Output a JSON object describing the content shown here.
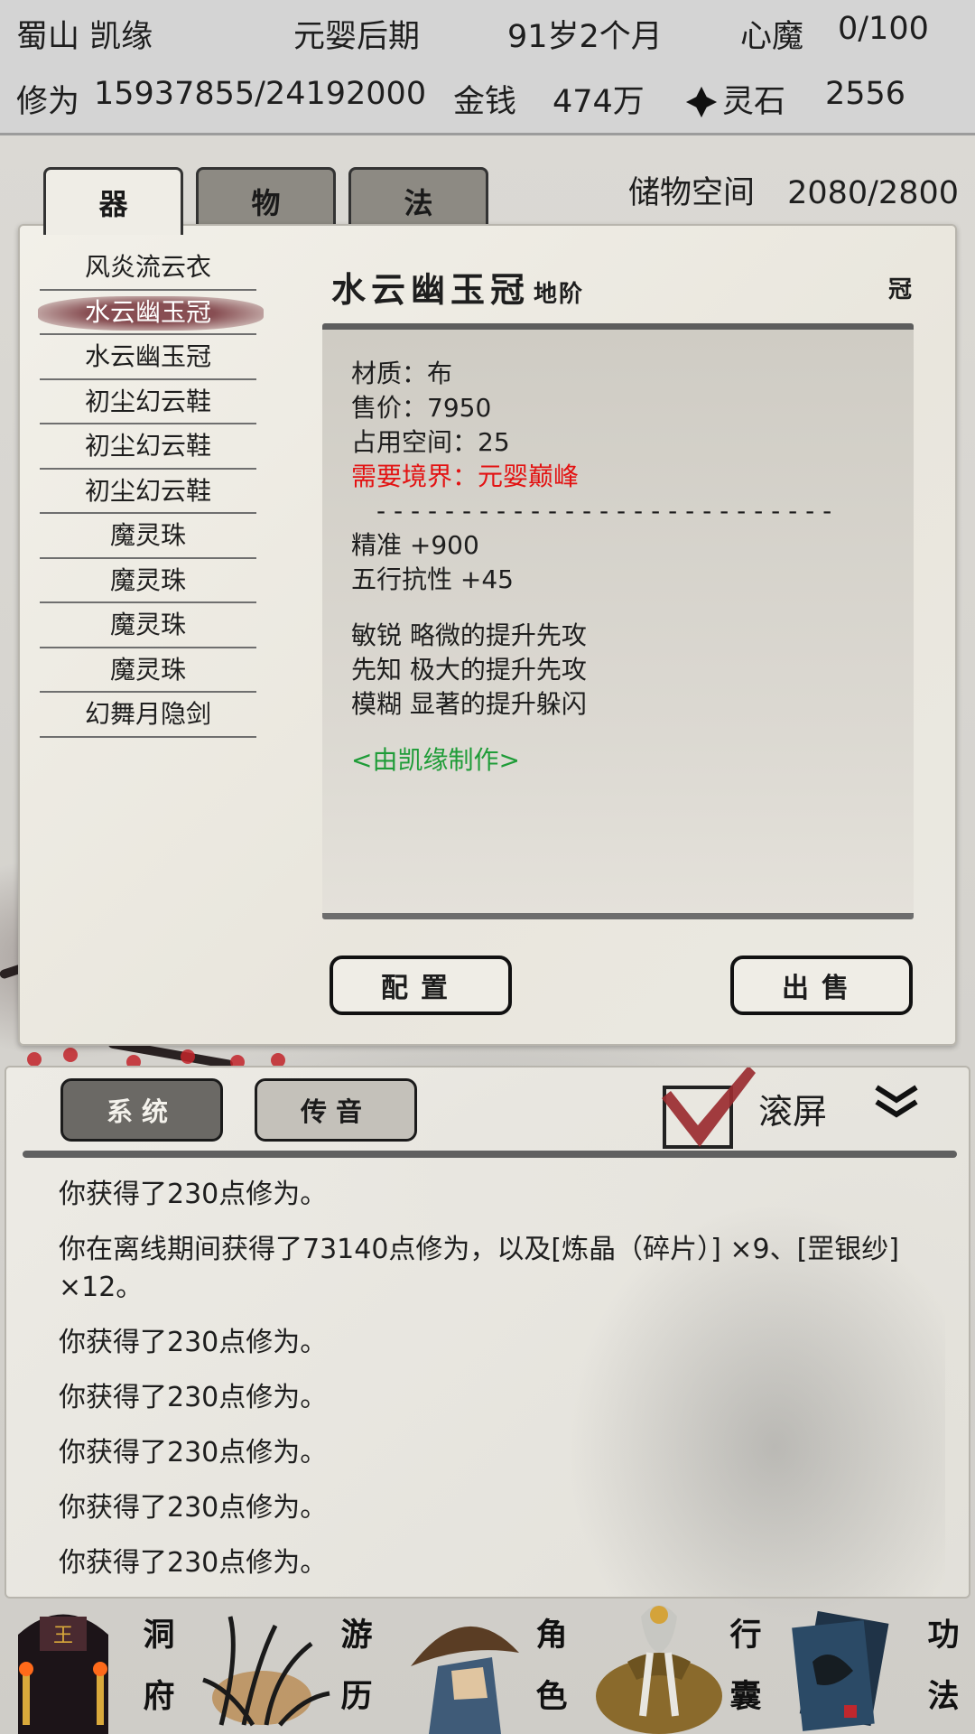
{
  "header": {
    "location_name": "蜀山 凯缘",
    "realm": "元婴后期",
    "age": "91岁2个月",
    "demon_label": "心魔",
    "demon_value": "0/100",
    "cultivation_label": "修为",
    "cultivation_value": "15937855/24192000",
    "money_label": "金钱",
    "money_value": "474万",
    "stone_label": "灵石",
    "stone_value": "2556"
  },
  "tabs": [
    "器",
    "物",
    "法"
  ],
  "storage": {
    "label": "储物空间",
    "value": "2080/2800"
  },
  "items": [
    "风炎流云衣",
    "水云幽玉冠",
    "水云幽玉冠",
    "初尘幻云鞋",
    "初尘幻云鞋",
    "初尘幻云鞋",
    "魔灵珠",
    "魔灵珠",
    "魔灵珠",
    "魔灵珠",
    "幻舞月隐剑"
  ],
  "detail": {
    "name": "水云幽玉冠",
    "grade": "地阶",
    "slot": "冠",
    "material": "材质：布",
    "price": "售价：7950",
    "space": "占用空间：25",
    "requirement": "需要境界：元婴巅峰",
    "divider": "- - - - - - - - - - - - - - - - - - - - - - - - - - -",
    "stat1": "精准 +900",
    "stat2": "五行抗性 +45",
    "trait1": "敏锐 略微的提升先攻",
    "trait2": "先知 极大的提升先攻",
    "trait3": "模糊 显著的提升躲闪",
    "maker": "<由凯缘制作>"
  },
  "buttons": {
    "equip": "配置",
    "sell": "出售"
  },
  "log": {
    "tab_system": "系统",
    "tab_message": "传音",
    "scroll_label": "滚屏",
    "lines": [
      "你获得了230点修为。",
      "你在离线期间获得了73140点修为，以及[炼晶（碎片）] ×9、[罡银纱] ×12。",
      "你获得了230点修为。",
      "你获得了230点修为。",
      "你获得了230点修为。",
      "你获得了230点修为。",
      "你获得了230点修为。"
    ]
  },
  "nav": {
    "cave": [
      "洞",
      "府"
    ],
    "travel": [
      "游",
      "历"
    ],
    "character": [
      "角",
      "色"
    ],
    "bag": [
      "行",
      "囊"
    ],
    "skills": [
      "功",
      "法"
    ]
  },
  "colors": {
    "requirement": "#e31212",
    "maker": "#1f9c38",
    "selected": "#824650"
  }
}
